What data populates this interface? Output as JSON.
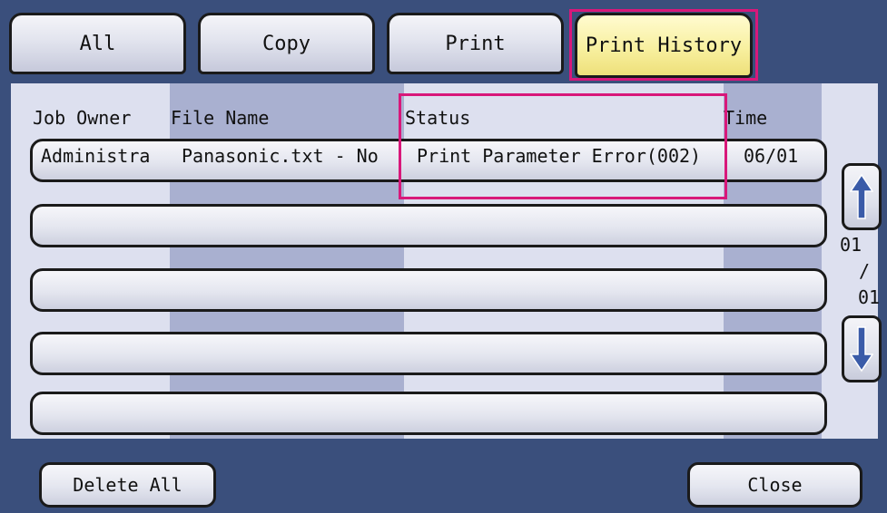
{
  "tabs": [
    {
      "label": "All",
      "active": false
    },
    {
      "label": "Copy",
      "active": false
    },
    {
      "label": "Print",
      "active": false
    },
    {
      "label": "Print History",
      "active": true
    }
  ],
  "columns": {
    "owner": "Job Owner",
    "file": "File Name",
    "status": "Status",
    "time": "Time"
  },
  "jobs": [
    {
      "owner": "Administra",
      "file": "Panasonic.txt - No",
      "status": "Print Parameter Error(002)",
      "time": "06/01"
    }
  ],
  "pager": {
    "current": "01",
    "separator": "/",
    "total": "01",
    "up_icon": "arrow-up-icon",
    "down_icon": "arrow-down-icon"
  },
  "buttons": {
    "delete_all": "Delete All",
    "close": "Close"
  },
  "colors": {
    "frame": "#3a4f7c",
    "panel": "#dde0ef",
    "stripe": "#a9b0d0",
    "active_tab": "#f8f0a0",
    "highlight": "#d8187a",
    "arrow": "#3a5ba8"
  }
}
